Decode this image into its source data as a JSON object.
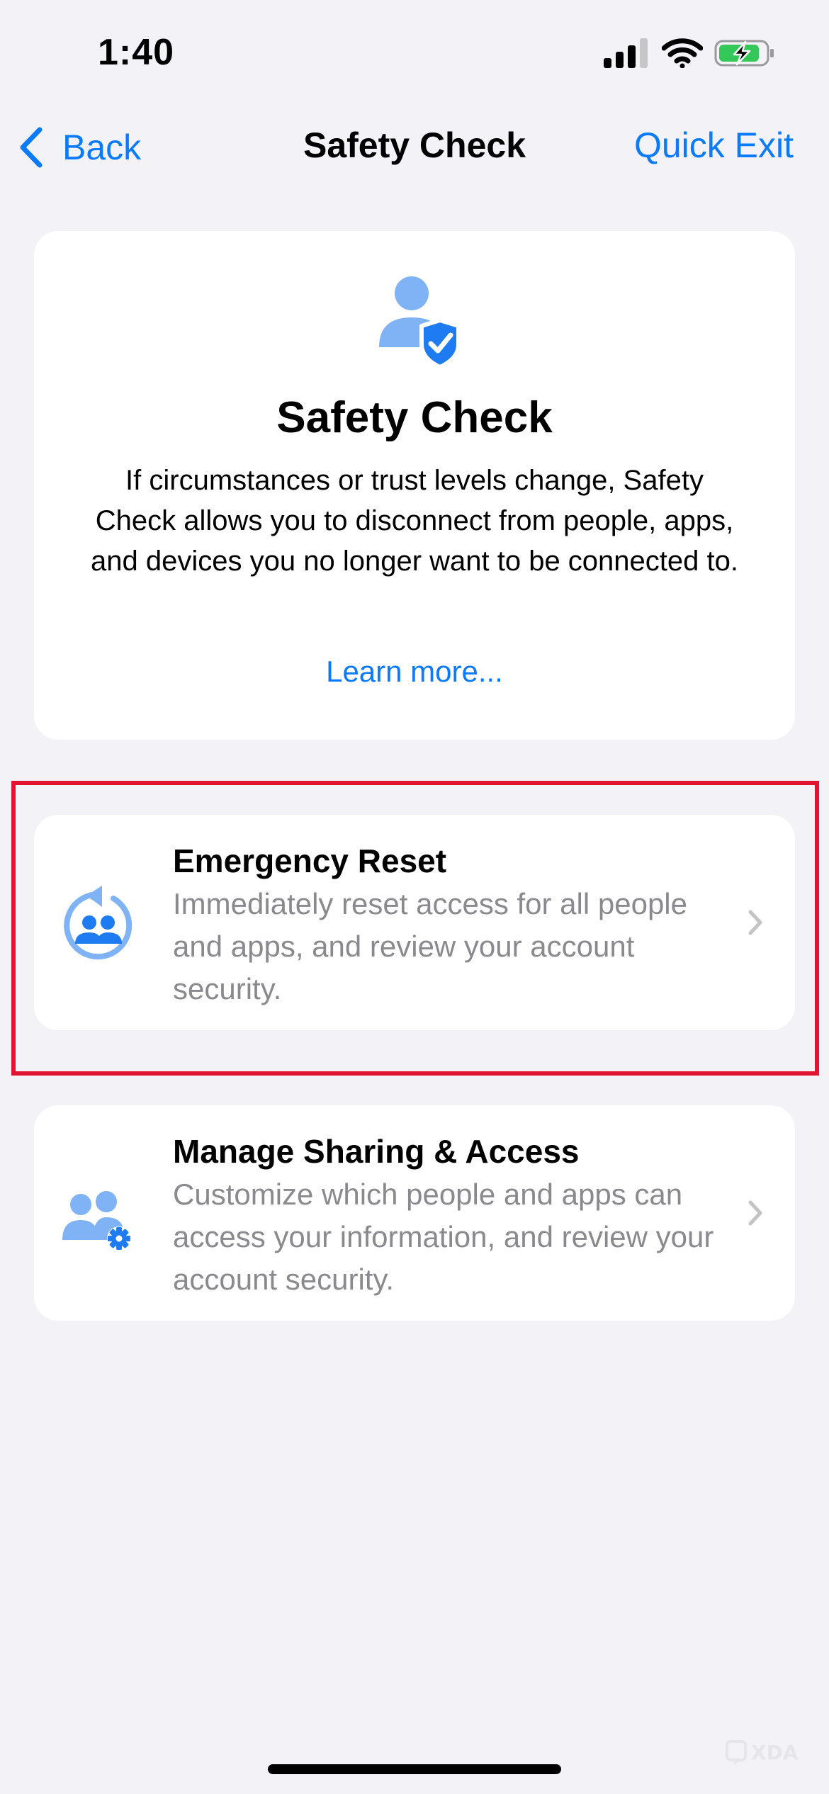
{
  "status_bar": {
    "time": "1:40",
    "icons": [
      "cellular-signal-icon",
      "wifi-icon",
      "battery-charging-icon"
    ]
  },
  "nav": {
    "back_label": "Back",
    "title": "Safety Check",
    "quick_exit_label": "Quick Exit"
  },
  "hero": {
    "icon": "person-shield-check-icon",
    "title": "Safety Check",
    "description": "If circumstances or trust levels change, Safety Check allows you to disconnect from people, apps, and devices you no longer want to be connected to.",
    "learn_more_label": "Learn more..."
  },
  "options": [
    {
      "icon": "emergency-reset-icon",
      "title": "Emergency Reset",
      "description": "Immediately reset access for all people and apps, and review your account security."
    },
    {
      "icon": "people-gear-icon",
      "title": "Manage Sharing & Access",
      "description": "Customize which people and apps can access your information, and review your account security."
    }
  ],
  "watermark": {
    "icon": "xda-logo-icon",
    "text": "XDA"
  },
  "colors": {
    "accent": "#0A7AFF",
    "icon_light_blue": "#7FB3F5",
    "icon_blue": "#1E7BF2",
    "highlight_red": "#E11432",
    "background": "#F2F2F7",
    "secondary_text": "#8A8A8E"
  }
}
